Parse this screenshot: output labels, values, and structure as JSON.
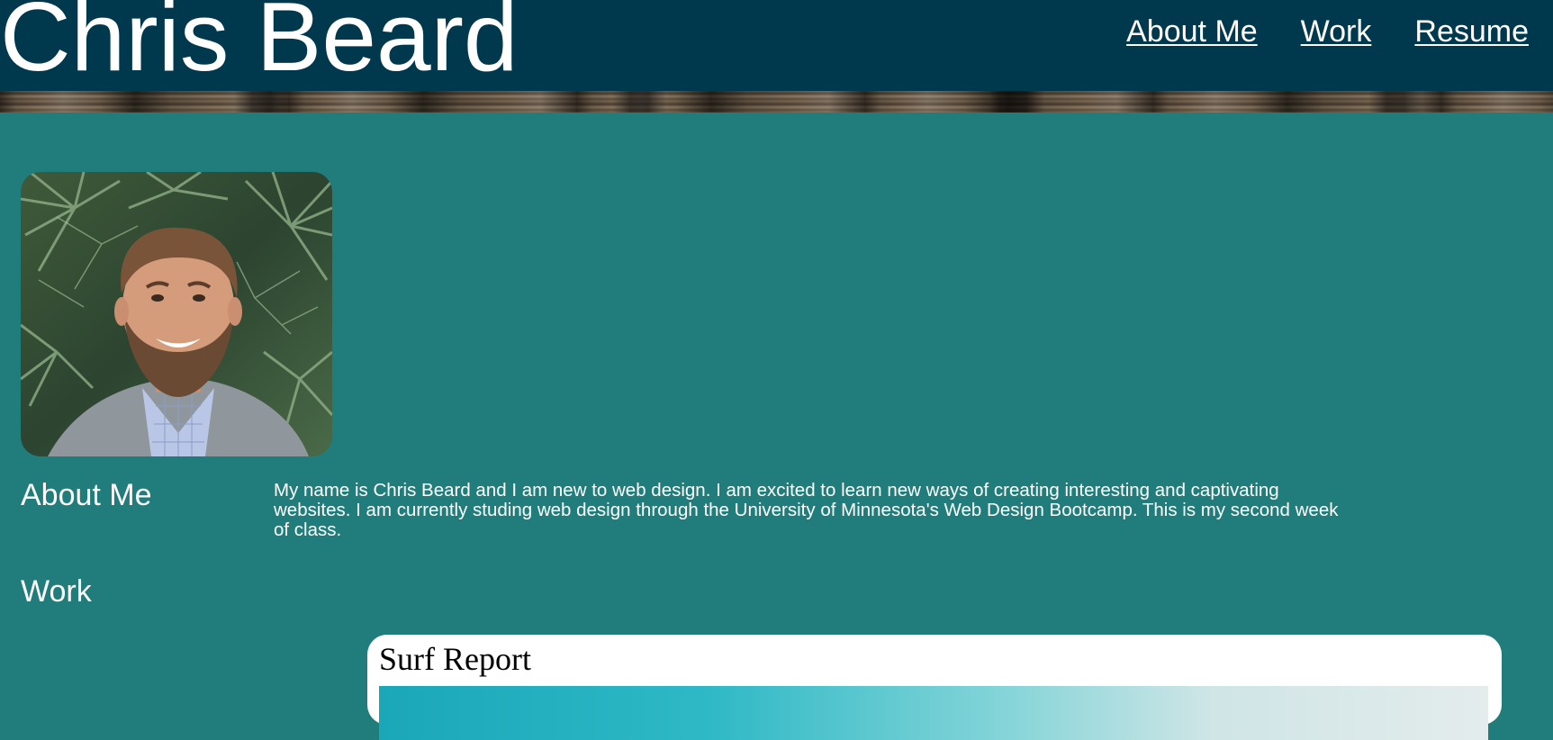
{
  "header": {
    "title": "Chris Beard",
    "nav": [
      {
        "label": "About Me"
      },
      {
        "label": "Work"
      },
      {
        "label": "Resume"
      }
    ],
    "background_color": "#00384e"
  },
  "profile": {
    "photo_alt": "Chris Beard"
  },
  "about": {
    "heading": "About Me",
    "text": "My name is Chris Beard and I am new to web design. I am excited to learn new ways of creating interesting and captivating websites. I am currently studing web design through the University of Minnesota's Web Design Bootcamp. This is my second week of class."
  },
  "work": {
    "heading": "Work",
    "items": [
      {
        "title": "Surf Report"
      }
    ]
  },
  "colors": {
    "page_background": "#207d7b",
    "text": "#ffffff",
    "card_background": "#ffffff"
  }
}
